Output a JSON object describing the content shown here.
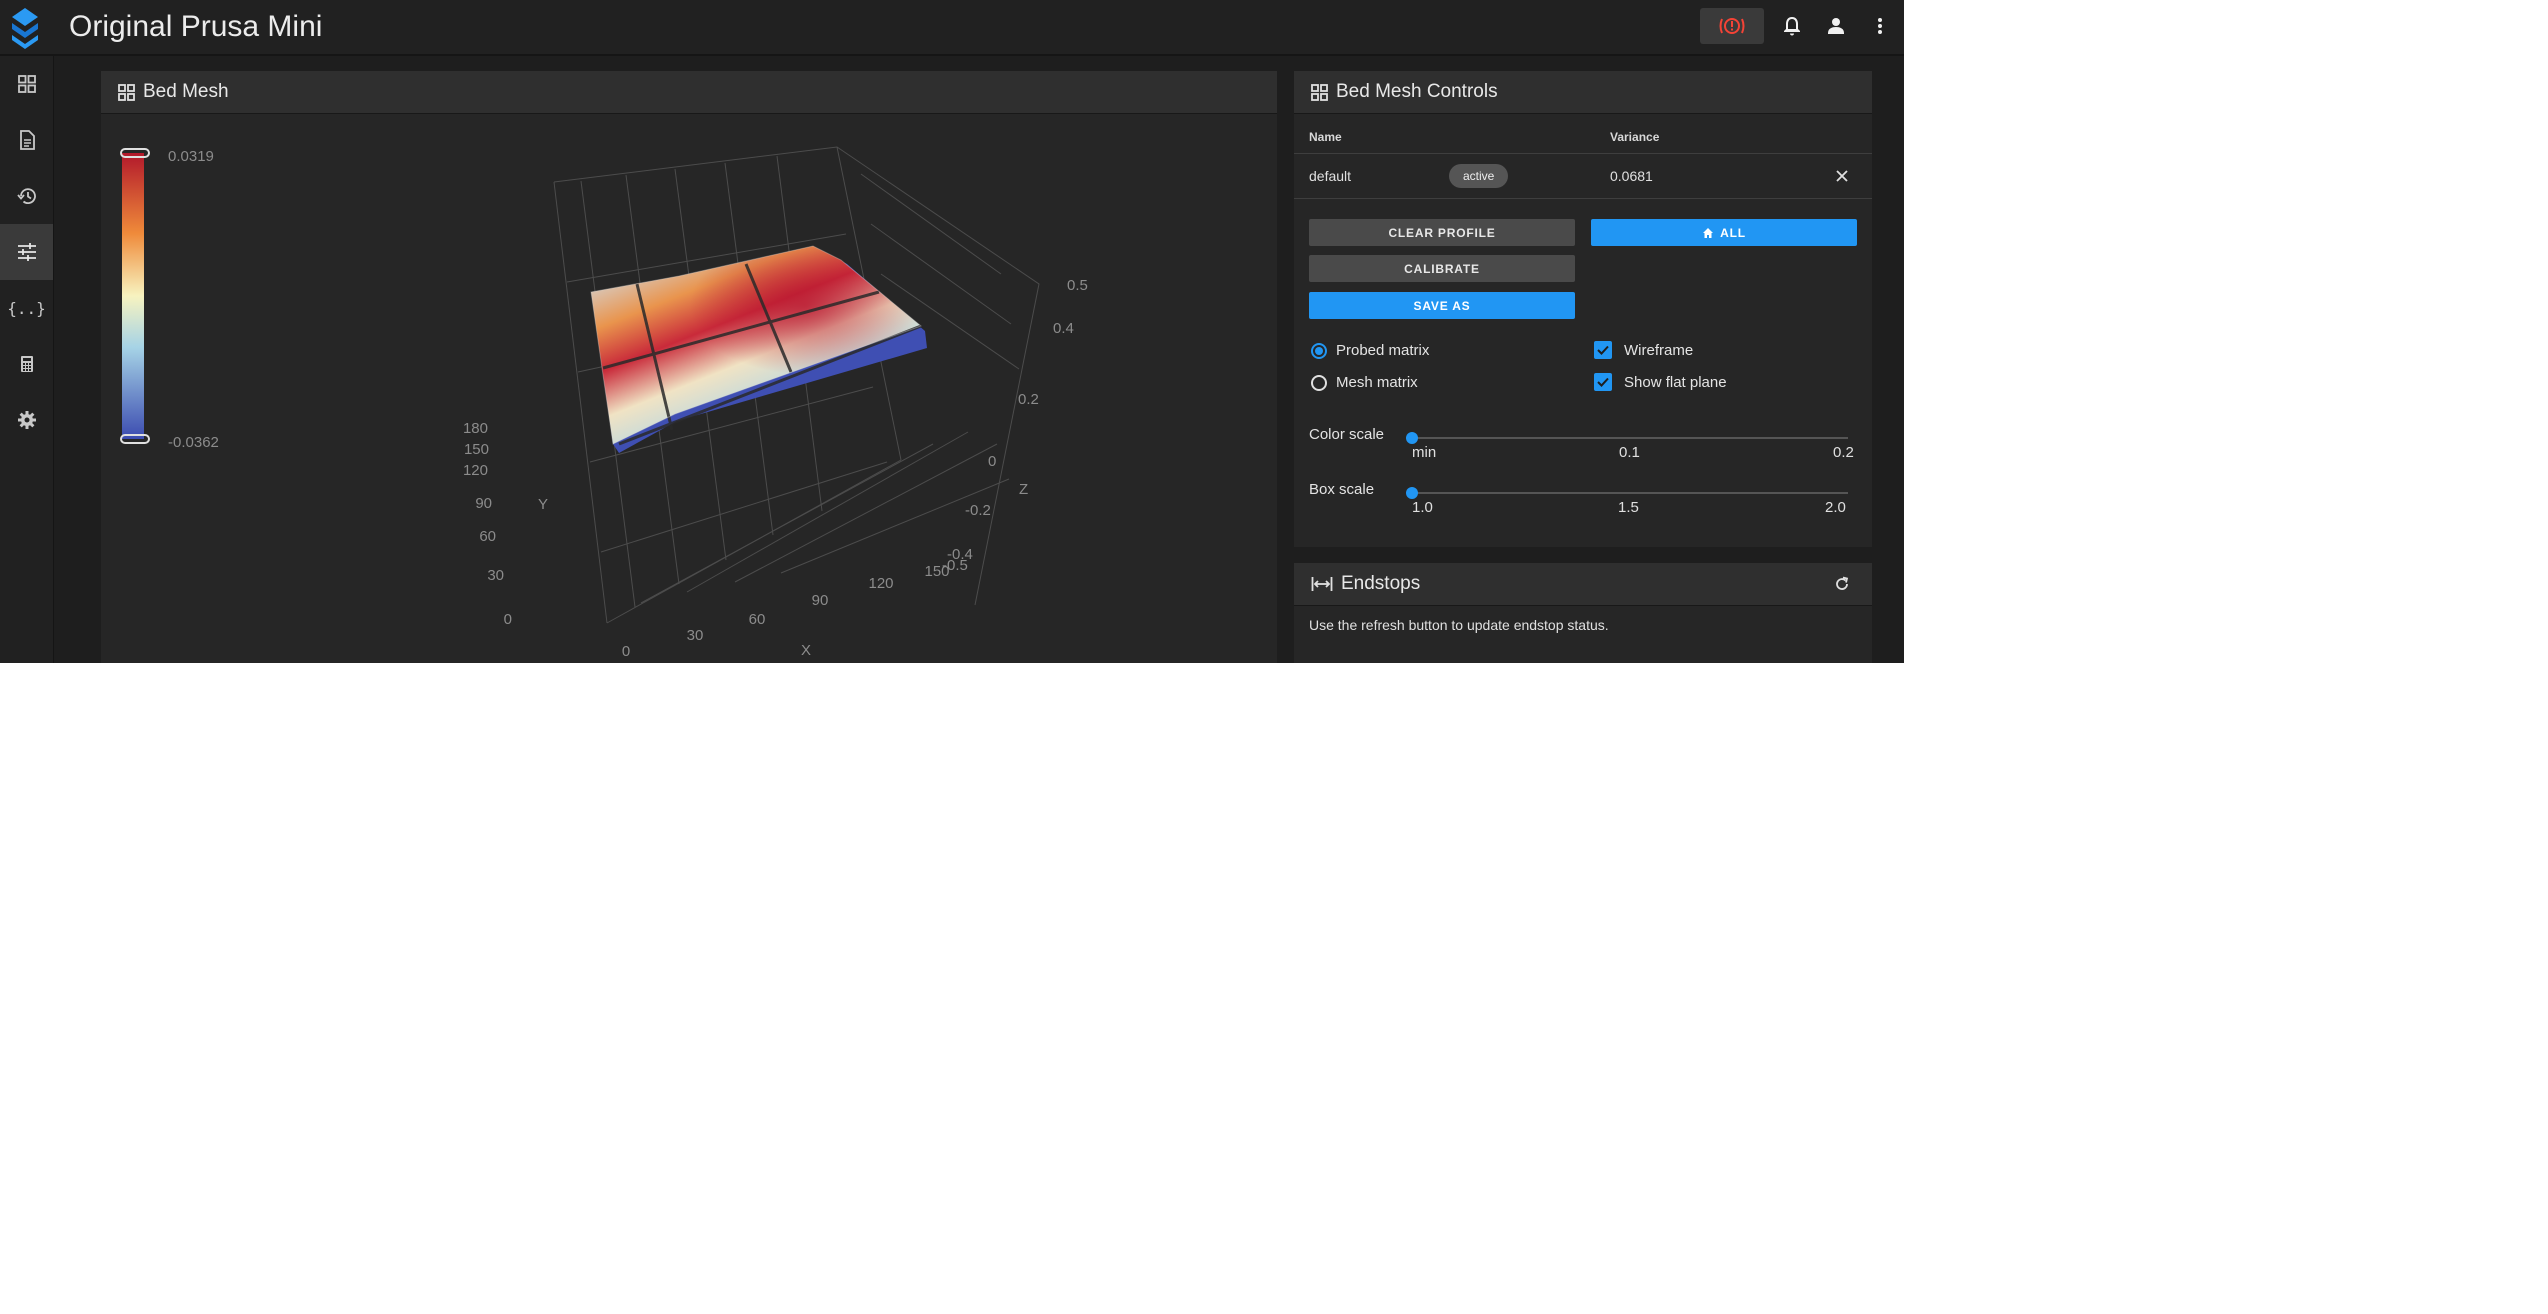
{
  "app": {
    "title": "Original Prusa Mini"
  },
  "header": {
    "icons": [
      "estop-icon",
      "bell-icon",
      "account-icon",
      "more-vertical-icon"
    ]
  },
  "nav": {
    "icons": [
      "dashboard-icon",
      "file-icon",
      "history-icon",
      "tune-icon",
      "macros-icon",
      "calculator-icon",
      "settings-icon"
    ],
    "active": "tune-icon"
  },
  "bed_mesh": {
    "title": "Bed Mesh",
    "color_bar": {
      "max": "0.0319",
      "min": "-0.0362"
    },
    "axes": {
      "x_label": "X",
      "y_label": "Y",
      "z_label": "Z",
      "x_ticks": [
        "0",
        "30",
        "60",
        "90",
        "120",
        "150"
      ],
      "y_ticks": [
        "0",
        "30",
        "60",
        "90",
        "120",
        "150",
        "180"
      ],
      "z_ticks": [
        "0.5",
        "0.4",
        "0.2",
        "0",
        "-0.2",
        "-0.4",
        "-0.5"
      ]
    }
  },
  "controls": {
    "title": "Bed Mesh Controls",
    "columns": {
      "name": "Name",
      "variance": "Variance"
    },
    "profile": {
      "name": "default",
      "status": "active",
      "variance": "0.0681"
    },
    "buttons": {
      "clear_profile": "CLEAR PROFILE",
      "home_all": "ALL",
      "calibrate": "CALIBRATE",
      "save_as": "SAVE AS"
    },
    "options": {
      "probed": "Probed matrix",
      "mesh": "Mesh matrix",
      "wireframe": "Wireframe",
      "flat_plane": "Show flat plane"
    },
    "selected_matrix": "probed",
    "wireframe_checked": true,
    "flat_plane_checked": true,
    "color_scale": {
      "label": "Color scale",
      "ticks": [
        "min",
        "0.1",
        "0.2"
      ],
      "value": 0
    },
    "box_scale": {
      "label": "Box scale",
      "ticks": [
        "1.0",
        "1.5",
        "2.0"
      ],
      "value": 1.0
    }
  },
  "endstops": {
    "title": "Endstops",
    "message": "Use the refresh button to update endstop status."
  }
}
